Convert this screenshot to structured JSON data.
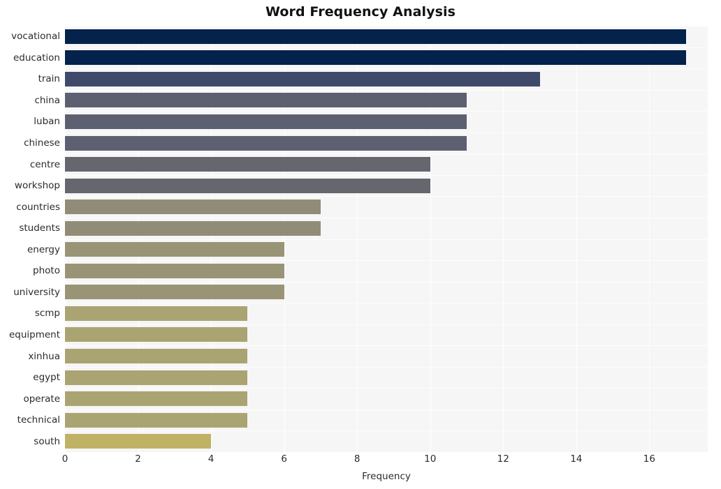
{
  "chart_data": {
    "type": "bar",
    "orientation": "horizontal",
    "title": "Word Frequency Analysis",
    "xlabel": "Frequency",
    "ylabel": "",
    "xlim": [
      0,
      17.6
    ],
    "ylim_categories": 20,
    "xticks": [
      0,
      2,
      4,
      6,
      8,
      10,
      12,
      14,
      16
    ],
    "xtick_labels": [
      "0",
      "2",
      "4",
      "6",
      "8",
      "10",
      "12",
      "14",
      "16"
    ],
    "grid": true,
    "grid_axis": "both",
    "legend": false,
    "categories": [
      "vocational",
      "education",
      "train",
      "china",
      "luban",
      "chinese",
      "centre",
      "workshop",
      "countries",
      "students",
      "energy",
      "photo",
      "university",
      "scmp",
      "equipment",
      "xinhua",
      "egypt",
      "operate",
      "technical",
      "south"
    ],
    "values": [
      17,
      17,
      13,
      11,
      11,
      11,
      10,
      10,
      7,
      7,
      6,
      6,
      6,
      5,
      5,
      5,
      5,
      5,
      5,
      4
    ],
    "bar_colors": [
      "#03224c",
      "#03224c",
      "#3f4a6b",
      "#5c6070",
      "#5c6070",
      "#5c6070",
      "#66666e",
      "#66666e",
      "#918c78",
      "#918c78",
      "#999476",
      "#999476",
      "#999476",
      "#aaa473",
      "#aaa473",
      "#aaa473",
      "#aaa473",
      "#aaa473",
      "#aaa473",
      "#c0b264"
    ],
    "plot_background": "#f6f6f7",
    "gridline_color": "#ffffff",
    "figure_background": "#ffffff",
    "tick_label_color": "#2b2b2b"
  }
}
